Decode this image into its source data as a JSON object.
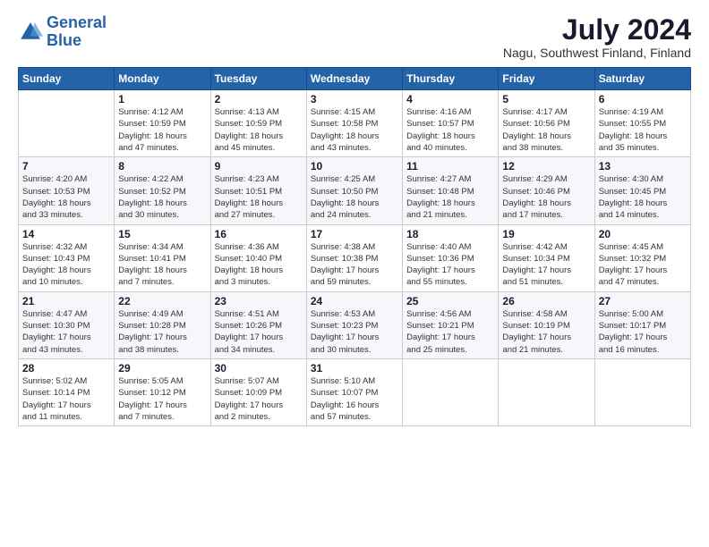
{
  "logo": {
    "line1": "General",
    "line2": "Blue"
  },
  "title": "July 2024",
  "location": "Nagu, Southwest Finland, Finland",
  "days_of_week": [
    "Sunday",
    "Monday",
    "Tuesday",
    "Wednesday",
    "Thursday",
    "Friday",
    "Saturday"
  ],
  "weeks": [
    [
      {
        "day": "",
        "info": ""
      },
      {
        "day": "1",
        "info": "Sunrise: 4:12 AM\nSunset: 10:59 PM\nDaylight: 18 hours\nand 47 minutes."
      },
      {
        "day": "2",
        "info": "Sunrise: 4:13 AM\nSunset: 10:59 PM\nDaylight: 18 hours\nand 45 minutes."
      },
      {
        "day": "3",
        "info": "Sunrise: 4:15 AM\nSunset: 10:58 PM\nDaylight: 18 hours\nand 43 minutes."
      },
      {
        "day": "4",
        "info": "Sunrise: 4:16 AM\nSunset: 10:57 PM\nDaylight: 18 hours\nand 40 minutes."
      },
      {
        "day": "5",
        "info": "Sunrise: 4:17 AM\nSunset: 10:56 PM\nDaylight: 18 hours\nand 38 minutes."
      },
      {
        "day": "6",
        "info": "Sunrise: 4:19 AM\nSunset: 10:55 PM\nDaylight: 18 hours\nand 35 minutes."
      }
    ],
    [
      {
        "day": "7",
        "info": "Sunrise: 4:20 AM\nSunset: 10:53 PM\nDaylight: 18 hours\nand 33 minutes."
      },
      {
        "day": "8",
        "info": "Sunrise: 4:22 AM\nSunset: 10:52 PM\nDaylight: 18 hours\nand 30 minutes."
      },
      {
        "day": "9",
        "info": "Sunrise: 4:23 AM\nSunset: 10:51 PM\nDaylight: 18 hours\nand 27 minutes."
      },
      {
        "day": "10",
        "info": "Sunrise: 4:25 AM\nSunset: 10:50 PM\nDaylight: 18 hours\nand 24 minutes."
      },
      {
        "day": "11",
        "info": "Sunrise: 4:27 AM\nSunset: 10:48 PM\nDaylight: 18 hours\nand 21 minutes."
      },
      {
        "day": "12",
        "info": "Sunrise: 4:29 AM\nSunset: 10:46 PM\nDaylight: 18 hours\nand 17 minutes."
      },
      {
        "day": "13",
        "info": "Sunrise: 4:30 AM\nSunset: 10:45 PM\nDaylight: 18 hours\nand 14 minutes."
      }
    ],
    [
      {
        "day": "14",
        "info": "Sunrise: 4:32 AM\nSunset: 10:43 PM\nDaylight: 18 hours\nand 10 minutes."
      },
      {
        "day": "15",
        "info": "Sunrise: 4:34 AM\nSunset: 10:41 PM\nDaylight: 18 hours\nand 7 minutes."
      },
      {
        "day": "16",
        "info": "Sunrise: 4:36 AM\nSunset: 10:40 PM\nDaylight: 18 hours\nand 3 minutes."
      },
      {
        "day": "17",
        "info": "Sunrise: 4:38 AM\nSunset: 10:38 PM\nDaylight: 17 hours\nand 59 minutes."
      },
      {
        "day": "18",
        "info": "Sunrise: 4:40 AM\nSunset: 10:36 PM\nDaylight: 17 hours\nand 55 minutes."
      },
      {
        "day": "19",
        "info": "Sunrise: 4:42 AM\nSunset: 10:34 PM\nDaylight: 17 hours\nand 51 minutes."
      },
      {
        "day": "20",
        "info": "Sunrise: 4:45 AM\nSunset: 10:32 PM\nDaylight: 17 hours\nand 47 minutes."
      }
    ],
    [
      {
        "day": "21",
        "info": "Sunrise: 4:47 AM\nSunset: 10:30 PM\nDaylight: 17 hours\nand 43 minutes."
      },
      {
        "day": "22",
        "info": "Sunrise: 4:49 AM\nSunset: 10:28 PM\nDaylight: 17 hours\nand 38 minutes."
      },
      {
        "day": "23",
        "info": "Sunrise: 4:51 AM\nSunset: 10:26 PM\nDaylight: 17 hours\nand 34 minutes."
      },
      {
        "day": "24",
        "info": "Sunrise: 4:53 AM\nSunset: 10:23 PM\nDaylight: 17 hours\nand 30 minutes."
      },
      {
        "day": "25",
        "info": "Sunrise: 4:56 AM\nSunset: 10:21 PM\nDaylight: 17 hours\nand 25 minutes."
      },
      {
        "day": "26",
        "info": "Sunrise: 4:58 AM\nSunset: 10:19 PM\nDaylight: 17 hours\nand 21 minutes."
      },
      {
        "day": "27",
        "info": "Sunrise: 5:00 AM\nSunset: 10:17 PM\nDaylight: 17 hours\nand 16 minutes."
      }
    ],
    [
      {
        "day": "28",
        "info": "Sunrise: 5:02 AM\nSunset: 10:14 PM\nDaylight: 17 hours\nand 11 minutes."
      },
      {
        "day": "29",
        "info": "Sunrise: 5:05 AM\nSunset: 10:12 PM\nDaylight: 17 hours\nand 7 minutes."
      },
      {
        "day": "30",
        "info": "Sunrise: 5:07 AM\nSunset: 10:09 PM\nDaylight: 17 hours\nand 2 minutes."
      },
      {
        "day": "31",
        "info": "Sunrise: 5:10 AM\nSunset: 10:07 PM\nDaylight: 16 hours\nand 57 minutes."
      },
      {
        "day": "",
        "info": ""
      },
      {
        "day": "",
        "info": ""
      },
      {
        "day": "",
        "info": ""
      }
    ]
  ]
}
